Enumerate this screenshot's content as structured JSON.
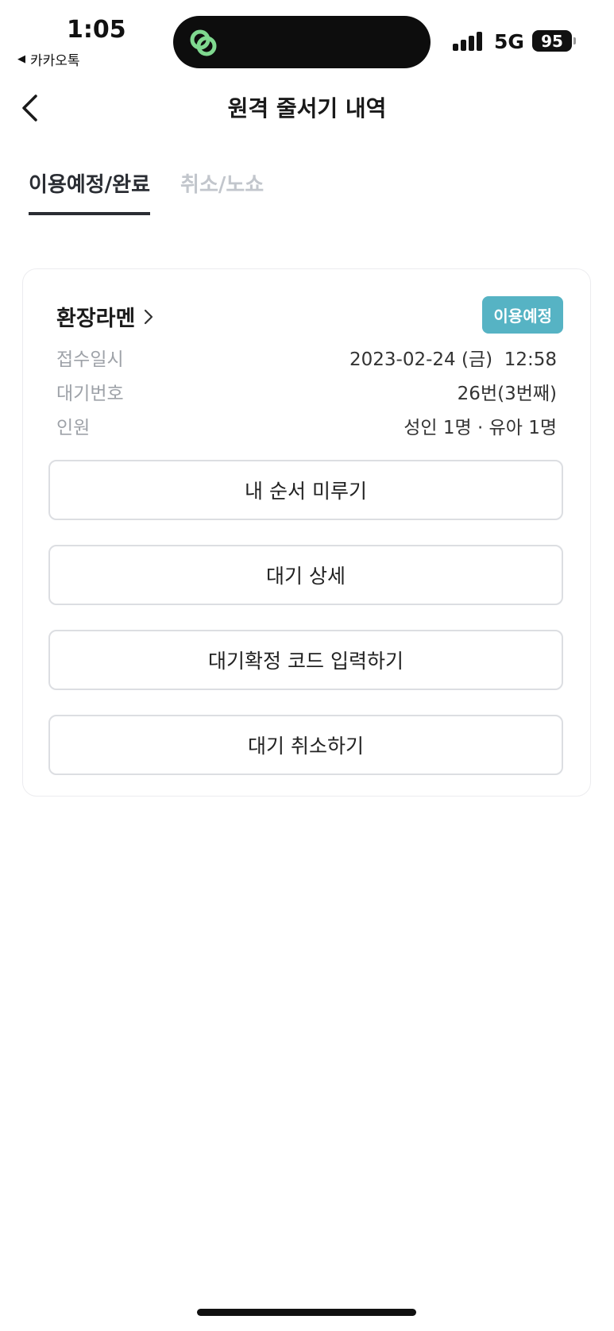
{
  "status_bar": {
    "time": "1:05",
    "back_app": "카카오톡",
    "network": "5G",
    "battery": "95",
    "island_icon_color": "#7fd88f"
  },
  "header": {
    "title": "원격 줄서기 내역",
    "back_icon": "chevron-left-icon"
  },
  "tabs": [
    {
      "label": "이용예정/완료",
      "active": true
    },
    {
      "label": "취소/노쇼",
      "active": false
    }
  ],
  "reservation": {
    "store_name": "환장라멘",
    "status_badge": "이용예정",
    "status_color": "#56b3c4",
    "rows": [
      {
        "label": "접수일시",
        "value": "2023-02-24 (금)  12:58"
      },
      {
        "label": "대기번호",
        "value": "26번(3번째)"
      },
      {
        "label": "인원",
        "value": "성인 1명 · 유아 1명"
      }
    ],
    "buttons": [
      {
        "label": "내 순서 미루기"
      },
      {
        "label": "대기 상세"
      },
      {
        "label": "대기확정 코드 입력하기"
      },
      {
        "label": "대기 취소하기"
      }
    ]
  }
}
